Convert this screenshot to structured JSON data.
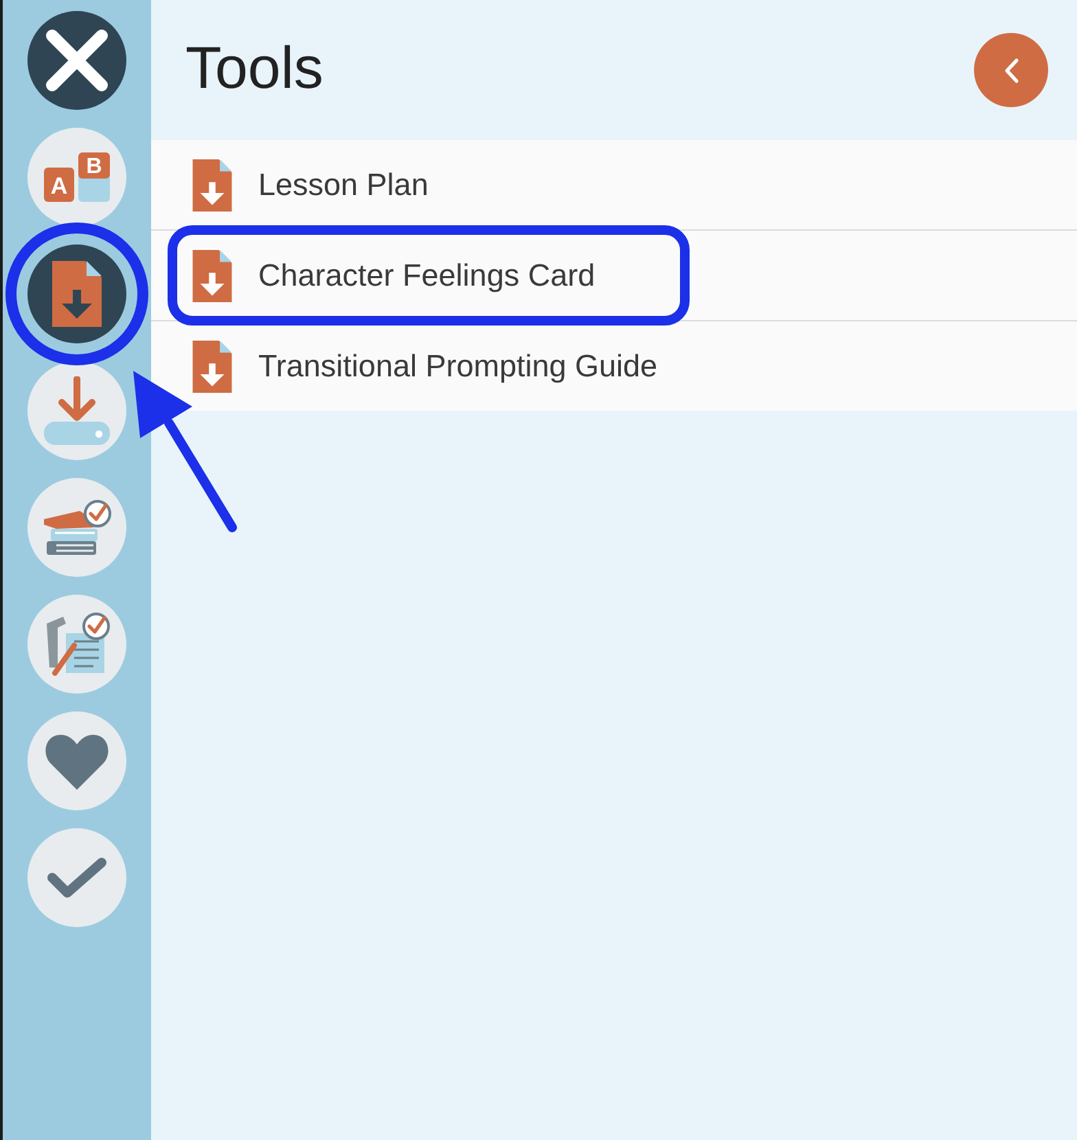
{
  "sidebar": {
    "items": [
      {
        "kind": "letters",
        "glyphs": [
          "A",
          "B"
        ],
        "selected": false,
        "highlighted": false
      },
      {
        "kind": "document",
        "selected": true,
        "highlighted": true
      },
      {
        "kind": "download",
        "selected": false,
        "highlighted": false
      },
      {
        "kind": "books",
        "selected": false,
        "highlighted": false
      },
      {
        "kind": "checklist",
        "selected": false,
        "highlighted": false
      },
      {
        "kind": "heart",
        "selected": false,
        "highlighted": false
      },
      {
        "kind": "check",
        "selected": false,
        "highlighted": false
      }
    ]
  },
  "header": {
    "title": "Tools"
  },
  "rows": [
    {
      "label": "Lesson Plan",
      "highlighted": false
    },
    {
      "label": "Character Feelings Card",
      "highlighted": true
    },
    {
      "label": "Transitional Prompting Guide",
      "highlighted": false
    }
  ]
}
